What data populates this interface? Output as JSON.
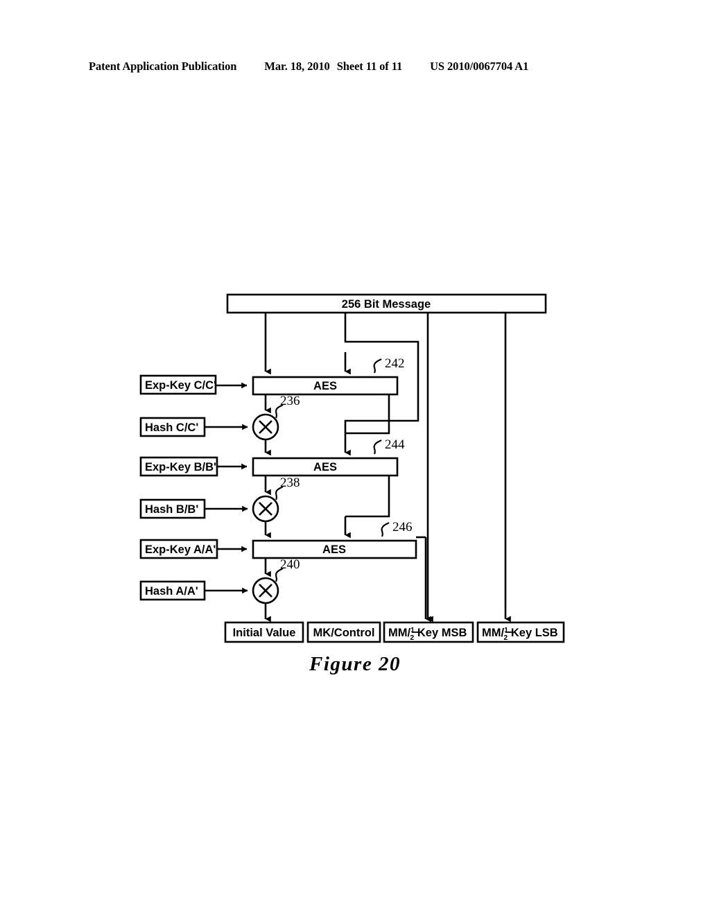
{
  "header": {
    "publication": "Patent Application Publication",
    "date": "Mar. 18, 2010",
    "sheet": "Sheet 11 of 11",
    "patent_number": "US 2010/0067704 A1"
  },
  "figure": {
    "caption": "Figure 20"
  },
  "diagram": {
    "message_box": {
      "label": "256 Bit Message"
    },
    "aes_blocks": [
      {
        "label": "AES",
        "ref": "242"
      },
      {
        "label": "AES",
        "ref": "244"
      },
      {
        "label": "AES",
        "ref": "246"
      }
    ],
    "key_boxes": [
      {
        "label": "Exp-Key C/C'"
      },
      {
        "label": "Exp-Key B/B'"
      },
      {
        "label": "Exp-Key A/A'"
      }
    ],
    "hash_boxes": [
      {
        "label": "Hash C/C'"
      },
      {
        "label": "Hash B/B'"
      },
      {
        "label": "Hash A/A'"
      }
    ],
    "xor_nodes": [
      {
        "symbol": "X",
        "ref": "236"
      },
      {
        "symbol": "X",
        "ref": "238"
      },
      {
        "symbol": "X",
        "ref": "240"
      }
    ],
    "output_boxes": [
      {
        "label": "Initial Value"
      },
      {
        "label": "MK/Control"
      },
      {
        "label_prefix": "MM/",
        "fraction_num": "1",
        "fraction_den": "2",
        "label_suffix": " Key MSB"
      },
      {
        "label_prefix": "MM/",
        "fraction_num": "1",
        "fraction_den": "2",
        "label_suffix": " Key LSB"
      }
    ],
    "colors": {
      "line": "#000000",
      "background": "#ffffff"
    }
  }
}
